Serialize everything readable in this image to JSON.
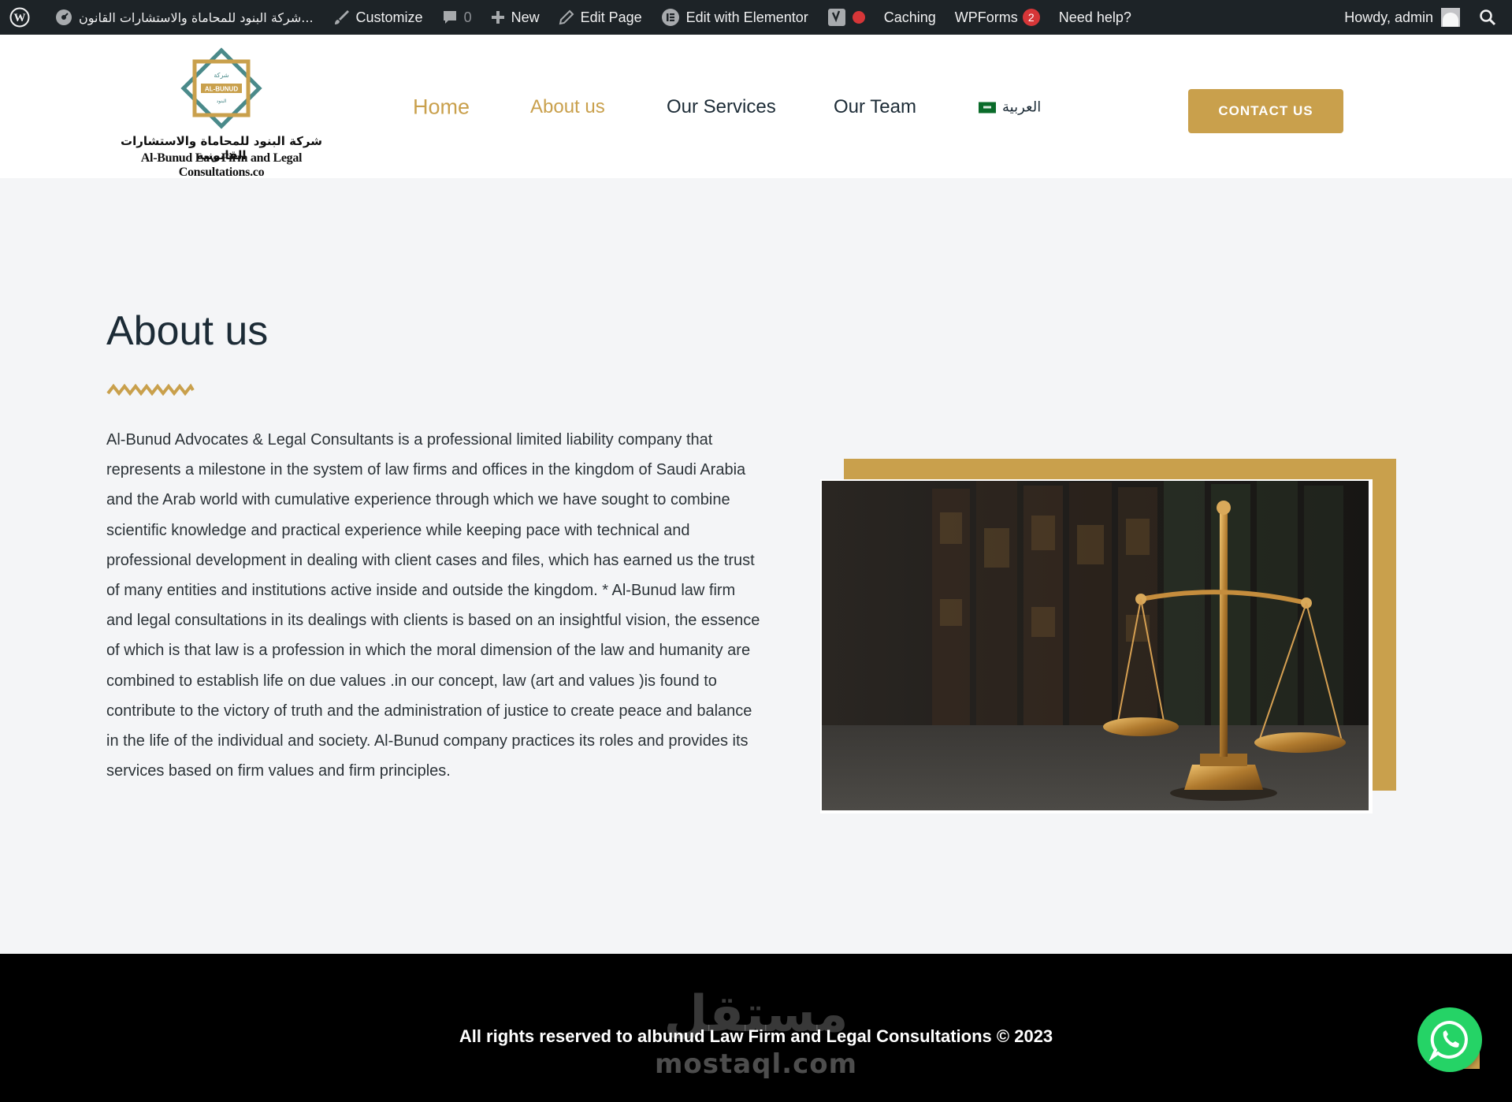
{
  "admin_bar": {
    "site_name": "شركة البنود للمحاماة والاستشارات القانون...",
    "customize": "Customize",
    "comments_count": "0",
    "new": "New",
    "edit_page": "Edit Page",
    "edit_elementor": "Edit with Elementor",
    "caching": "Caching",
    "wpforms": "WPForms",
    "wpforms_badge": "2",
    "need_help": "Need help?",
    "howdy": "Howdy, admin"
  },
  "header": {
    "logo_arabic_name": "شركة البنود للمحاماة والاستشارات القانونية",
    "logo_english_name": "Al-Bunud Law Firm and Legal Consultations.co",
    "nav": {
      "home": "Home",
      "about": "About us",
      "services": "Our Services",
      "team": "Our Team",
      "language": "العربية"
    },
    "contact_button": "CONTACT US"
  },
  "main": {
    "title": "About us",
    "body": "Al-Bunud Advocates & Legal Consultants is a professional limited liability company that represents a milestone in the system of law firms and offices in the kingdom of Saudi Arabia and the Arab world with cumulative experience through which we have sought to combine scientific knowledge and practical experience while keeping pace with technical and professional development in dealing with client cases and files, which has earned us the trust of many entities and institutions active inside and outside the kingdom. * Al-Bunud law firm and legal consultations in its dealings with clients is based on an insightful vision, the essence of which is that law is a profession in which the moral dimension of the law and humanity are combined to establish life on due values .in our concept, law (art and values )is found to contribute to the victory of truth and the administration of justice to create peace and balance in the life of the individual and society. Al-Bunud company practices its roles and provides its services based on firm values and firm principles."
  },
  "footer": {
    "copyright": "All rights reserved to albunud Law Firm and Legal Consultations © 2023",
    "watermark_arabic": "مستقل",
    "watermark_latin": "mostaql.com"
  },
  "colors": {
    "accent_gold": "#c9a04c",
    "admin_bar_bg": "#1d2327",
    "heading": "#1c2b36",
    "whatsapp": "#25d366",
    "badge_red": "#d63638"
  }
}
